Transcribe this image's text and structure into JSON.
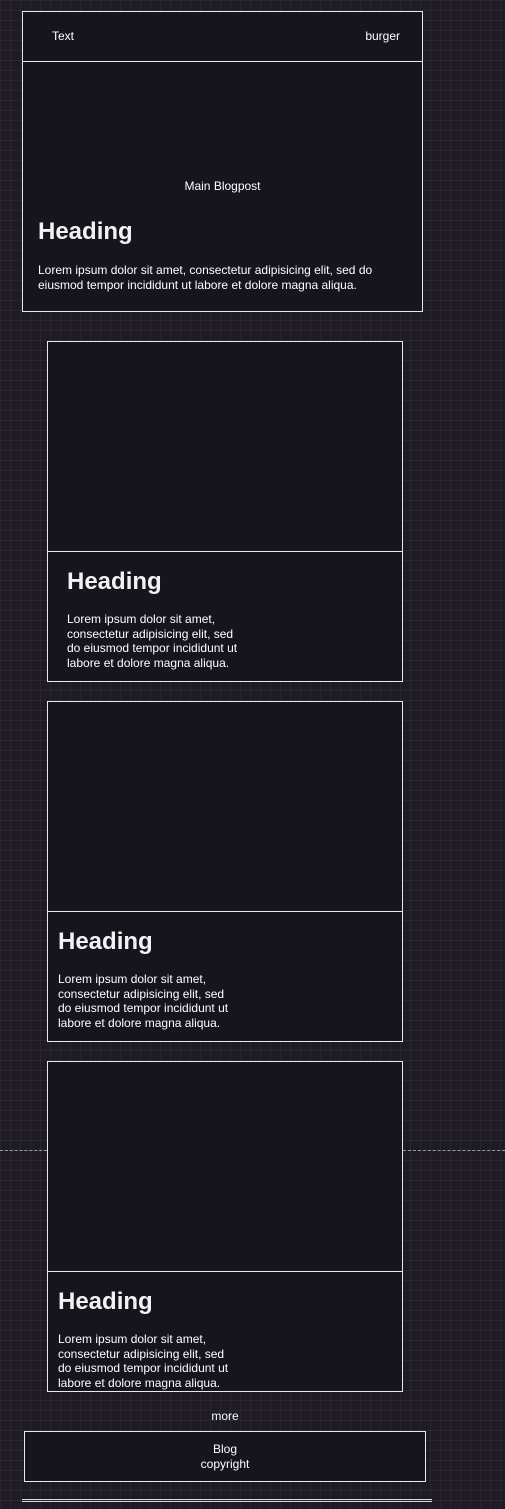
{
  "header": {
    "left_text": "Text",
    "burger_label": "burger"
  },
  "main_post": {
    "label": "Main Blogpost",
    "heading": "Heading",
    "body": "Lorem ipsum dolor sit amet, consectetur adipisicing elit, sed do eiusmod tempor incididunt ut labore et dolore magna aliqua."
  },
  "posts": [
    {
      "heading": "Heading",
      "body": "Lorem ipsum dolor sit amet, consectetur adipisicing elit, sed do eiusmod tempor incididunt ut labore et dolore magna aliqua."
    },
    {
      "heading": "Heading",
      "body": "Lorem ipsum dolor sit amet, consectetur adipisicing elit, sed do eiusmod tempor incididunt ut labore et dolore magna aliqua."
    },
    {
      "heading": "Heading",
      "body": "Lorem ipsum dolor sit amet, consectetur adipisicing elit, sed do eiusmod tempor incididunt ut labore et dolore magna aliqua."
    }
  ],
  "more_label": "more",
  "footer": {
    "line1": "Blog",
    "line2": "copyright"
  },
  "colors": {
    "background": "#1e1b24",
    "panel": "#16141d",
    "border": "#e8e8ee",
    "text": "#ffffff"
  }
}
